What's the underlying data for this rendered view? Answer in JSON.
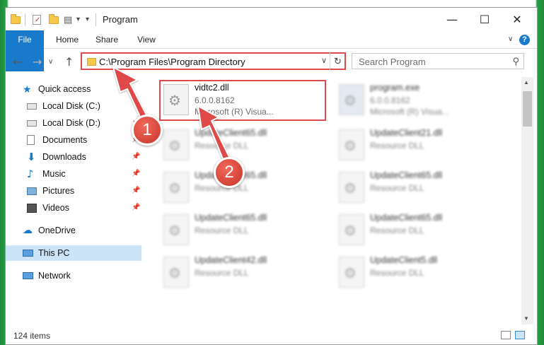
{
  "window": {
    "title": "Program",
    "controls": {
      "minimize": "—",
      "maximize": "☐",
      "close": "✕"
    }
  },
  "ribbon": {
    "tabs": [
      {
        "label": "File"
      },
      {
        "label": "Home"
      },
      {
        "label": "Share"
      },
      {
        "label": "View"
      }
    ],
    "expand_glyph": "∨",
    "help_glyph": "?",
    "accent": "#1979ca"
  },
  "nav": {
    "back": "←",
    "forward": "→",
    "recent": "∨",
    "up": "↑",
    "address": "C:\\Program Files\\Program Directory",
    "dropdown": "∨",
    "refresh": "↻",
    "search_placeholder": "Search Program",
    "search_icon": "search-icon"
  },
  "sidebar": {
    "items": [
      {
        "label": "Quick access",
        "icon": "star-icon"
      },
      {
        "label": "Local Disk (C:)",
        "icon": "drive-icon"
      },
      {
        "label": "Local Disk (D:)",
        "icon": "drive-icon"
      },
      {
        "label": "Documents",
        "icon": "documents-icon"
      },
      {
        "label": "Downloads",
        "icon": "download-icon"
      },
      {
        "label": "Music",
        "icon": "music-icon"
      },
      {
        "label": "Pictures",
        "icon": "pictures-icon"
      },
      {
        "label": "Videos",
        "icon": "videos-icon"
      },
      {
        "label": "OneDrive",
        "icon": "cloud-icon"
      },
      {
        "label": "This PC",
        "icon": "computer-icon"
      },
      {
        "label": "Network",
        "icon": "network-icon"
      }
    ],
    "selected": "This PC"
  },
  "files": [
    {
      "name": "vidtc2.dll",
      "line1": "6.0.0.8162",
      "line2": "Microsoft (R) Visua...",
      "highlighted": true
    },
    {
      "name": "program.exe",
      "line1": "6.0.0.8162",
      "line2": "Microsoft (R) Visua..."
    },
    {
      "name": "UpdateClient65.dll",
      "line1": "Resource DLL"
    },
    {
      "name": "UpdateClient21.dll",
      "line1": "Resource DLL"
    },
    {
      "name": "UpdateClient65.dll",
      "line1": "Resource DLL"
    },
    {
      "name": "UpdateClient65.dll",
      "line1": "Resource DLL"
    },
    {
      "name": "UpdateClient65.dll",
      "line1": "Resource DLL"
    },
    {
      "name": "UpdateClient65.dll",
      "line1": "Resource DLL"
    },
    {
      "name": "UpdateClient42.dll",
      "line1": "Resource DLL"
    },
    {
      "name": "UpdateClient5.dll",
      "line1": "Resource DLL"
    }
  ],
  "status": {
    "count": "124 items"
  },
  "annotations": {
    "step1": "1",
    "step2": "2",
    "color": "#e04a4a"
  }
}
